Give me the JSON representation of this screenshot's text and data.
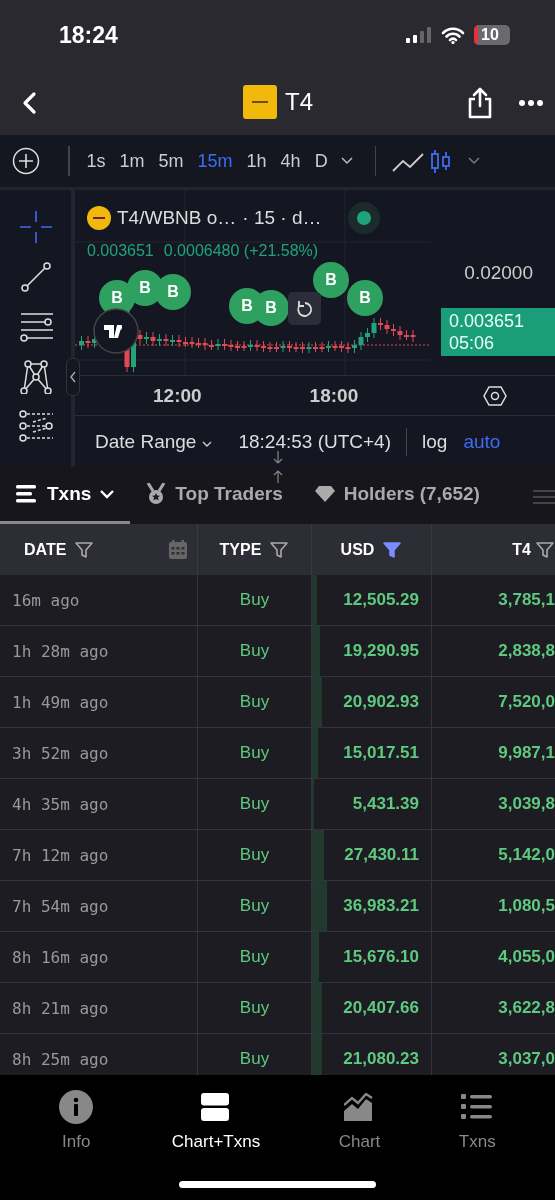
{
  "status_bar": {
    "time": "18:24",
    "battery": "10"
  },
  "nav": {
    "title": "T4"
  },
  "timeframes": [
    {
      "label": "1s",
      "selected": false
    },
    {
      "label": "1m",
      "selected": false
    },
    {
      "label": "5m",
      "selected": false
    },
    {
      "label": "15m",
      "selected": true
    },
    {
      "label": "1h",
      "selected": false
    },
    {
      "label": "4h",
      "selected": false
    },
    {
      "label": "D",
      "selected": false
    }
  ],
  "chart_types": [
    {
      "kind": "line",
      "selected": false
    },
    {
      "kind": "candles",
      "selected": true
    }
  ],
  "chart": {
    "pair": "T4/WBNB o…",
    "interval": "· 15 · d…",
    "price": "0.003651",
    "change": "0.0006480 (+21.58%)",
    "price_tick": "0.02000",
    "last_price": "0.003651",
    "countdown": "05:06",
    "time_labels": [
      "12:00",
      "18:00"
    ],
    "trade_markers": [
      {
        "label": "B"
      },
      {
        "label": "B"
      },
      {
        "label": "B"
      },
      {
        "label": "B"
      },
      {
        "label": "B"
      },
      {
        "label": "B"
      },
      {
        "label": "B"
      }
    ]
  },
  "chart_footer": {
    "date_range": "Date Range",
    "clock": "18:24:53 (UTC+4)",
    "scales": [
      {
        "label": "log",
        "selected": false
      },
      {
        "label": "auto",
        "selected": true
      }
    ]
  },
  "tabs": [
    {
      "label": "Txns",
      "selected": true
    },
    {
      "label": "Top Traders",
      "selected": false
    },
    {
      "label": "Holders (7,652)",
      "selected": false
    }
  ],
  "table": {
    "columns": [
      {
        "label": "DATE",
        "filter_active": false
      },
      {
        "label": "TYPE",
        "filter_active": false
      },
      {
        "label": "USD",
        "filter_active": true
      },
      {
        "label": "T4",
        "filter_active": false
      }
    ],
    "rows": [
      {
        "date": "16m ago",
        "type": "Buy",
        "usd": "12,505.29",
        "level": 0.04,
        "t4": "3,785,1"
      },
      {
        "date": "1h 28m ago",
        "type": "Buy",
        "usd": "19,290.95",
        "level": 0.07,
        "t4": "2,838,8"
      },
      {
        "date": "1h 49m ago",
        "type": "Buy",
        "usd": "20,902.93",
        "level": 0.08,
        "t4": "7,520,0"
      },
      {
        "date": "3h 52m ago",
        "type": "Buy",
        "usd": "15,017.51",
        "level": 0.05,
        "t4": "9,987,1"
      },
      {
        "date": "4h 35m ago",
        "type": "Buy",
        "usd": "5,431.39",
        "level": 0.02,
        "t4": "3,039,8"
      },
      {
        "date": "7h 12m ago",
        "type": "Buy",
        "usd": "27,430.11",
        "level": 0.1,
        "t4": "5,142,0"
      },
      {
        "date": "7h 54m ago",
        "type": "Buy",
        "usd": "36,983.21",
        "level": 0.13,
        "t4": "1,080,5"
      },
      {
        "date": "8h 16m ago",
        "type": "Buy",
        "usd": "15,676.10",
        "level": 0.06,
        "t4": "4,055,0"
      },
      {
        "date": "8h 21m ago",
        "type": "Buy",
        "usd": "20,407.66",
        "level": 0.08,
        "t4": "3,622,8"
      },
      {
        "date": "8h 25m ago",
        "type": "Buy",
        "usd": "21,080.23",
        "level": 0.08,
        "t4": "3,037,0"
      }
    ]
  },
  "bottom_nav": [
    {
      "label": "Info",
      "selected": false
    },
    {
      "label": "Chart+Txns",
      "selected": true
    },
    {
      "label": "Chart",
      "selected": false
    },
    {
      "label": "Txns",
      "selected": false
    }
  ]
}
